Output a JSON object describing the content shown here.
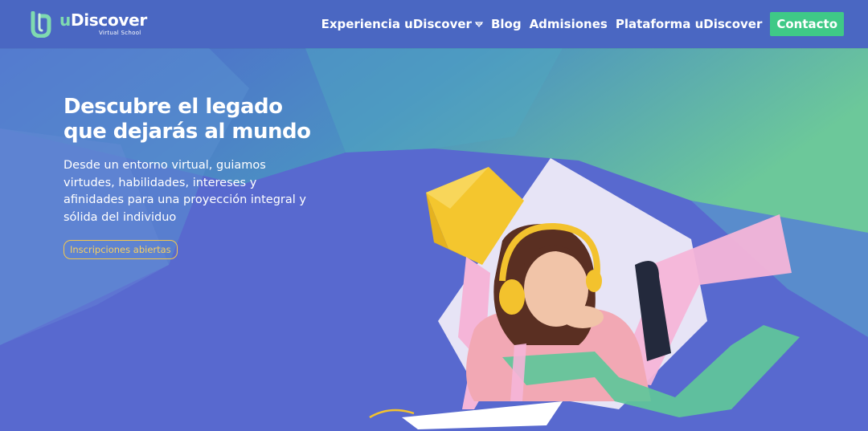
{
  "brand": {
    "name_prefix": "u",
    "name_rest": "Discover",
    "tagline": "Virtual School"
  },
  "nav": {
    "items": [
      {
        "label": "Experiencia uDiscover",
        "has_dropdown": true
      },
      {
        "label": "Blog"
      },
      {
        "label": "Admisiones"
      },
      {
        "label": "Plataforma uDiscover"
      }
    ],
    "cta_label": "Contacto"
  },
  "hero": {
    "title": "Descubre el legado que dejarás al mundo",
    "description": "Desde un entorno virtual, guiamos virtudes, habilidades, intereses y afinidades para una proyección integral y sólida del individuo",
    "cta_label": "Inscripciones abiertas"
  },
  "colors": {
    "header_bg": "#4a67c2",
    "accent_green": "#3fc987",
    "accent_yellow": "#f5c84b",
    "hero_bg": "#5868cf"
  },
  "icons": {
    "logo": "udiscover-logo-icon",
    "dropdown": "caret-down-icon"
  }
}
